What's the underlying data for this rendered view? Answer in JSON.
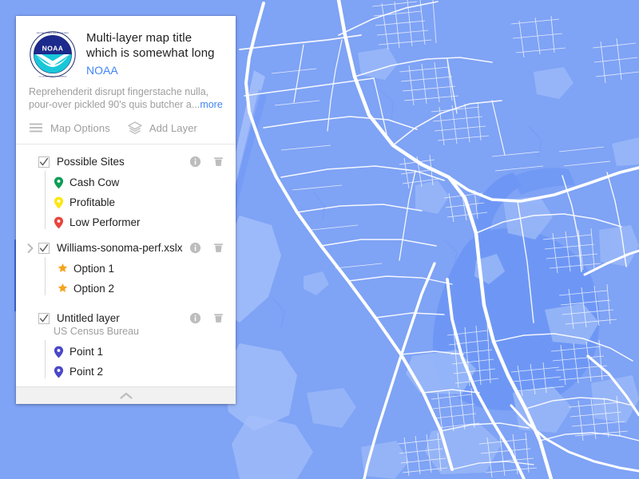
{
  "map": {
    "alt": "Blue-tinted street map of the San Francisco Bay Area",
    "colors": {
      "land": "#7fa3f5",
      "water": "#6e97f5",
      "park": "#9ab8f8",
      "road": "#ffffff"
    }
  },
  "panel": {
    "title": "Multi-layer map title which is somewhat long",
    "owner": "NOAA",
    "logo_icon": "noaa-logo",
    "description": "Reprehenderit disrupt fingerstache nulla, pour-over pickled 90's quis butcher a...",
    "more_label": "more",
    "toolbar": {
      "map_options_label": "Map Options",
      "map_options_icon": "hamburger-icon",
      "add_layer_label": "Add Layer",
      "add_layer_icon": "layers-icon"
    },
    "info_icon": "info-icon",
    "delete_icon": "trash-icon",
    "collapse_icon": "chevron-up-icon",
    "layers": [
      {
        "name": "Possible Sites",
        "checked": true,
        "expandable": false,
        "subtitle": null,
        "has_actions": true,
        "items": [
          {
            "label": "Cash Cow",
            "icon": "map-pin-icon",
            "color": "#0f9d58"
          },
          {
            "label": "Profitable",
            "icon": "map-pin-icon",
            "color": "#fbe712"
          },
          {
            "label": "Low Performer",
            "icon": "map-pin-icon",
            "color": "#e8453c"
          }
        ]
      },
      {
        "name": "Williams-sonoma-perf.xslx",
        "checked": true,
        "expandable": true,
        "expanded": true,
        "subtitle": null,
        "has_actions": true,
        "items": [
          {
            "label": "Option 1",
            "icon": "star-icon",
            "color": "#f4a41d"
          },
          {
            "label": "Option 2",
            "icon": "star-icon",
            "color": "#f4a41d"
          }
        ]
      },
      {
        "name": "Untitled layer",
        "checked": true,
        "expandable": false,
        "subtitle": "US Census Bureau",
        "has_actions": true,
        "items": [
          {
            "label": "Point 1",
            "icon": "map-pin-icon",
            "color": "#4b48c8"
          },
          {
            "label": "Point 2",
            "icon": "map-pin-icon",
            "color": "#4b48c8"
          }
        ]
      }
    ]
  }
}
